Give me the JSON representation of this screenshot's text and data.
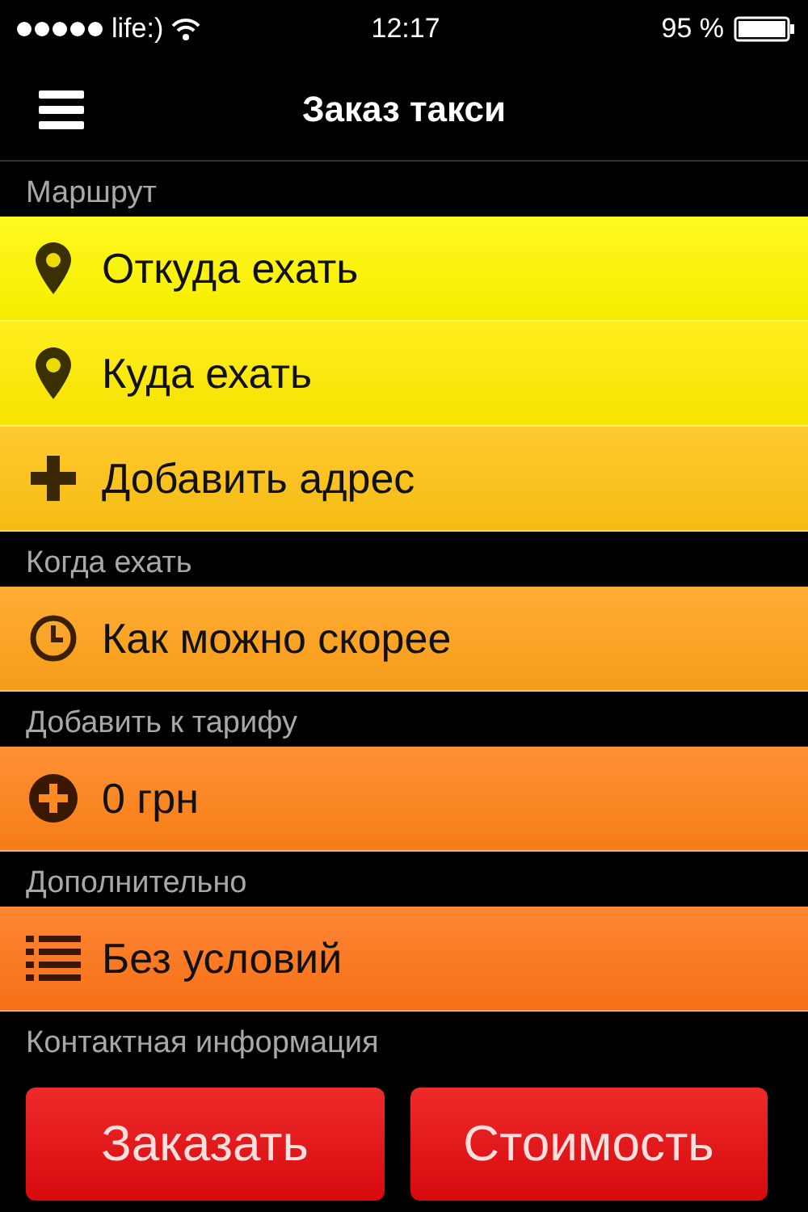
{
  "status_bar": {
    "carrier": "life:)",
    "time": "12:17",
    "battery": "95 %"
  },
  "nav_bar": {
    "title": "Заказ такси"
  },
  "sections": [
    {
      "title": "Маршрут",
      "rows": [
        {
          "kind": "pin",
          "label": "Откуда ехать",
          "color": "#fff700"
        },
        {
          "kind": "pin",
          "label": "Куда ехать",
          "color": "#ffec00"
        },
        {
          "kind": "plus",
          "label": "Добавить адрес",
          "color": "#ffc313"
        }
      ]
    },
    {
      "title": "Когда ехать",
      "rows": [
        {
          "kind": "clock",
          "label": "Как можно скорее",
          "color": "#ffa21a"
        }
      ]
    },
    {
      "title": "Добавить к тарифу",
      "rows": [
        {
          "kind": "plus-circle",
          "label": "0 грн",
          "color": "#ff8218"
        }
      ]
    },
    {
      "title": "Дополнительно",
      "rows": [
        {
          "kind": "list",
          "label": "Без условий",
          "color": "#ff7518"
        }
      ]
    },
    {
      "title": "Контактная информация"
    }
  ],
  "buttons": [
    {
      "label": "Заказать"
    },
    {
      "label": "Стоимость"
    }
  ]
}
